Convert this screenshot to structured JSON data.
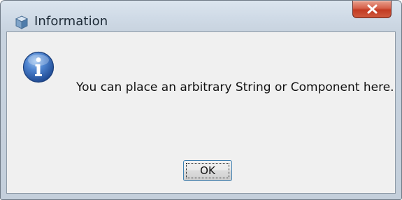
{
  "window": {
    "title": "Information",
    "title_icon": "java-cube-icon",
    "close_label": "close",
    "close_icon": "close-x-icon"
  },
  "dialog": {
    "icon": "information-icon",
    "message": "You can place an arbitrary String or Component here.",
    "ok_label": "OK"
  },
  "colors": {
    "frame": "#c8d3df",
    "client": "#f0f0f0",
    "close_button": "#c23a22",
    "info_icon": "#2f5fa8",
    "ok_border": "#3c7fb1"
  }
}
